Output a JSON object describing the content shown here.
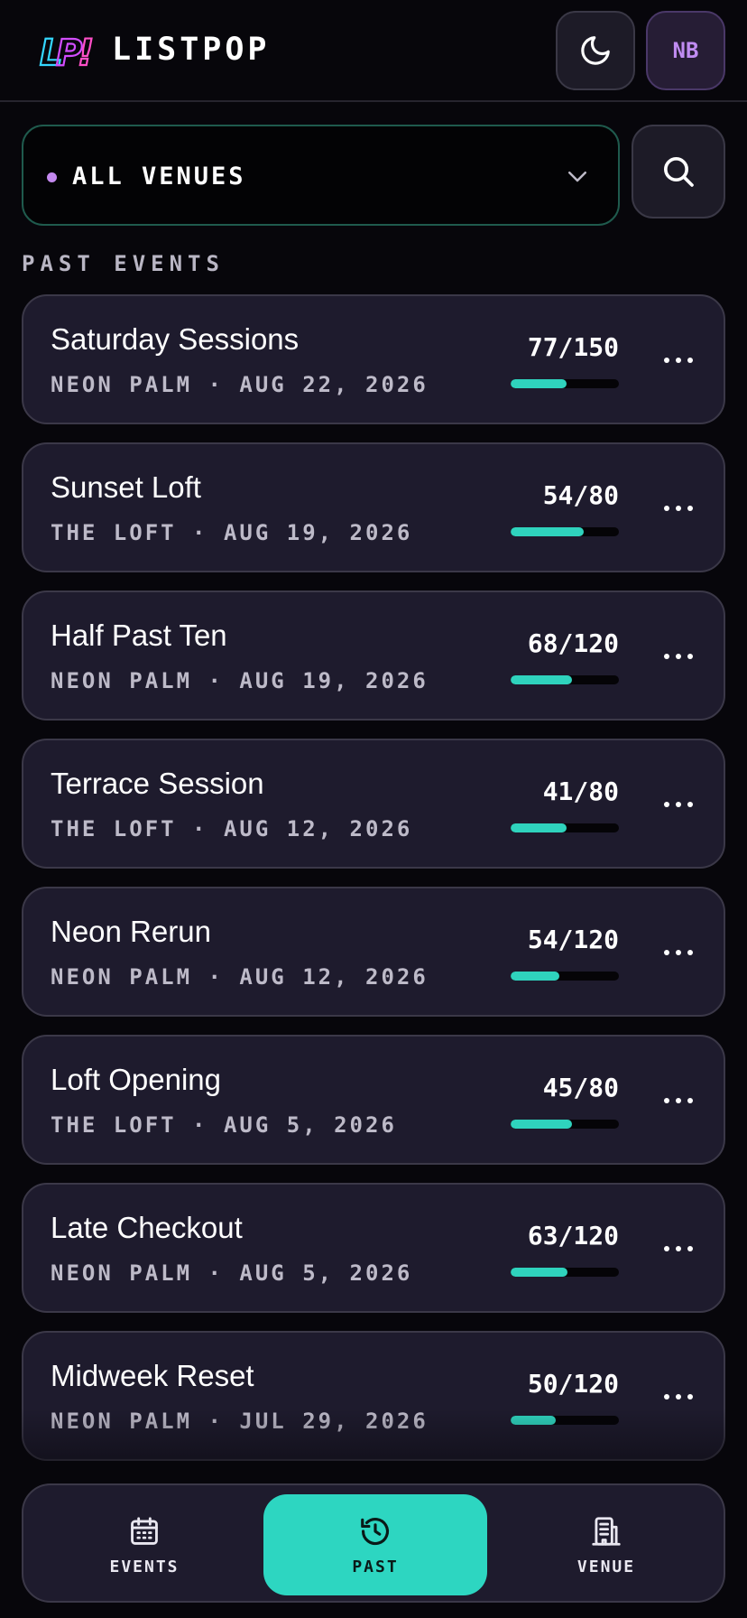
{
  "header": {
    "logo_text": "LP!",
    "brand": "LISTPOP",
    "theme_icon": "moon-icon",
    "avatar_initials": "NB"
  },
  "filter": {
    "venue_label": "ALL VENUES",
    "search_icon": "search-icon"
  },
  "section_title": "PAST EVENTS",
  "events": [
    {
      "name": "Saturday Sessions",
      "venue": "NEON PALM",
      "date": "AUG 22, 2026",
      "count": "77/150",
      "fill": 0.513
    },
    {
      "name": "Sunset Loft",
      "venue": "THE LOFT",
      "date": "AUG 19, 2026",
      "count": "54/80",
      "fill": 0.675
    },
    {
      "name": "Half Past Ten",
      "venue": "NEON PALM",
      "date": "AUG 19, 2026",
      "count": "68/120",
      "fill": 0.567
    },
    {
      "name": "Terrace Session",
      "venue": "THE LOFT",
      "date": "AUG 12, 2026",
      "count": "41/80",
      "fill": 0.513
    },
    {
      "name": "Neon Rerun",
      "venue": "NEON PALM",
      "date": "AUG 12, 2026",
      "count": "54/120",
      "fill": 0.45
    },
    {
      "name": "Loft Opening",
      "venue": "THE LOFT",
      "date": "AUG 5, 2026",
      "count": "45/80",
      "fill": 0.563
    },
    {
      "name": "Late Checkout",
      "venue": "NEON PALM",
      "date": "AUG 5, 2026",
      "count": "63/120",
      "fill": 0.525
    },
    {
      "name": "Midweek Reset",
      "venue": "NEON PALM",
      "date": "JUL 29, 2026",
      "count": "50/120",
      "fill": 0.417
    }
  ],
  "nav": {
    "items": [
      {
        "label": "EVENTS",
        "icon": "calendar-icon",
        "active": false
      },
      {
        "label": "PAST",
        "icon": "history-icon",
        "active": true
      },
      {
        "label": "VENUE",
        "icon": "building-icon",
        "active": false
      }
    ]
  },
  "colors": {
    "accent": "#2fd3bd",
    "purple": "#c489ef",
    "card": "#1e1b2d",
    "background": "#07060b"
  }
}
